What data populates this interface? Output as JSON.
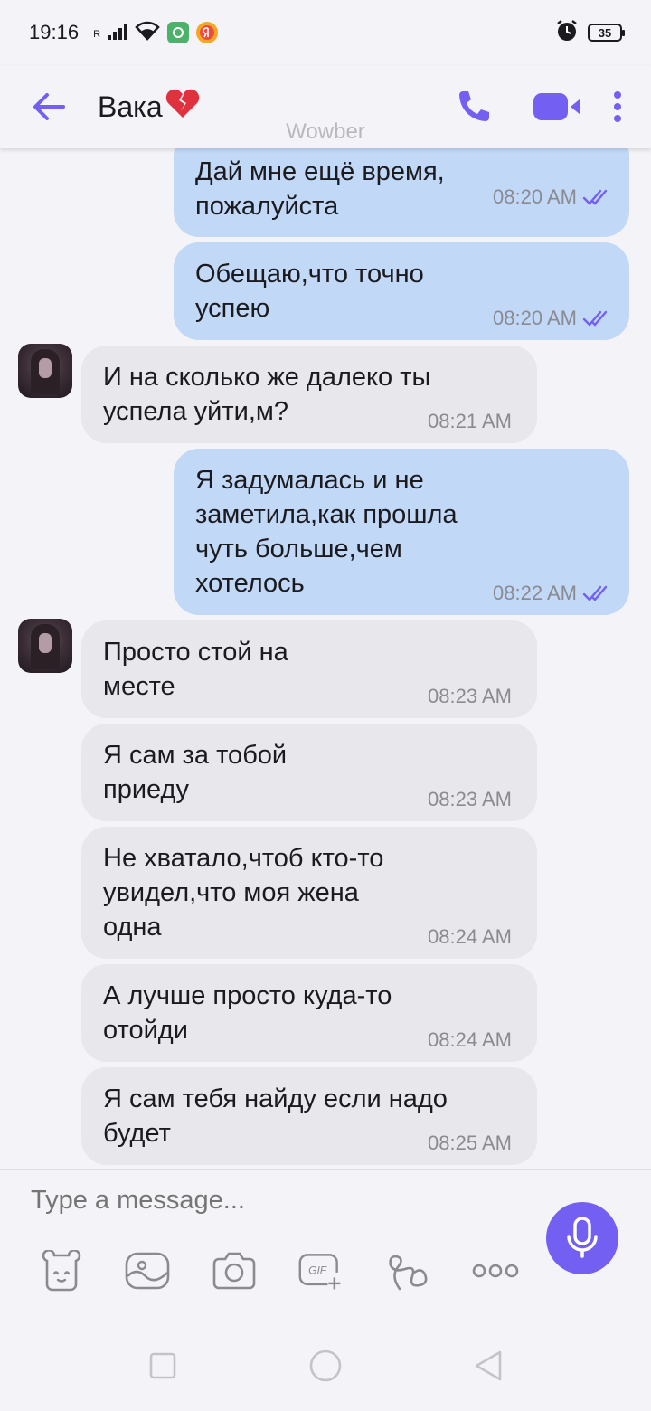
{
  "status_bar": {
    "time": "19:16",
    "signal_label": "R",
    "battery": "35",
    "icons": [
      "signal-icon",
      "wifi-icon",
      "app-badge-icon",
      "yandex-icon",
      "alarm-icon",
      "battery-icon"
    ]
  },
  "header": {
    "contact_name": "Вака",
    "contact_emoji": "💔",
    "watermark": "Wowber",
    "accent_color": "#7360f2"
  },
  "messages": [
    {
      "direction": "out",
      "text": "Дай мне ещё время,\nпожалуйста",
      "time": "08:20 AM",
      "read": true
    },
    {
      "direction": "out",
      "text": "Обещаю,что точно\nуспею",
      "time": "08:20 AM",
      "read": true
    },
    {
      "direction": "in",
      "text": "И на сколько же далеко ты\nуспела уйти,м?",
      "time": "08:21 AM",
      "avatar": true
    },
    {
      "direction": "out",
      "text": "Я задумалась и не\nзаметила,как прошла\nчуть больше,чем\nхотелось",
      "time": "08:22 AM",
      "read": true
    },
    {
      "direction": "in",
      "text": "Просто стой на\nместе",
      "time": "08:23 AM",
      "avatar": true
    },
    {
      "direction": "in",
      "text": "Я сам за тобой\nприеду",
      "time": "08:23 AM"
    },
    {
      "direction": "in",
      "text": "Не хватало,чтоб кто-то\nувидел,что моя жена\nодна",
      "time": "08:24 AM"
    },
    {
      "direction": "in",
      "text": "А лучше просто куда-то\nотойди",
      "time": "08:24 AM"
    },
    {
      "direction": "in",
      "text": "Я сам тебя найду если надо\nбудет",
      "time": "08:25 AM"
    }
  ],
  "composer": {
    "placeholder": "Type a message...",
    "tools": [
      "sticker-icon",
      "gallery-icon",
      "camera-icon",
      "gif-icon",
      "doodle-icon",
      "more-icon"
    ],
    "gif_label": "GIF"
  },
  "colors": {
    "outgoing_bubble": "#c2d8f7",
    "incoming_bubble": "#e8e8ec",
    "read_ticks": "#7360f2",
    "background": "#f4f3f7"
  }
}
